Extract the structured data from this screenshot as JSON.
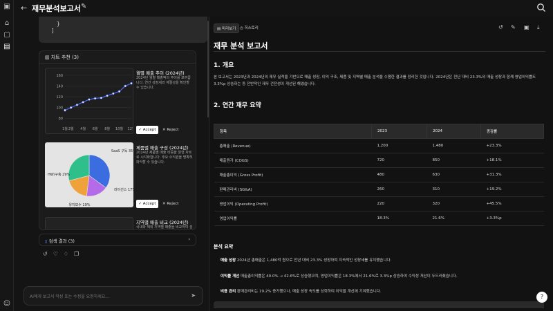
{
  "header": {
    "title": "재무분석보고서"
  },
  "chat": {
    "code_lines": [
      "}",
      "]"
    ],
    "recommend": {
      "label": "차트 추천 (3)",
      "cards": [
        {
          "title": "월별 매출 추이 (2024년)",
          "desc": "2024년 월별 매출액의 추이를 보여줍니다. 연간 성장세와 계절성을 확인할 수 있습니다.",
          "accept": "Accept",
          "reject": "Reject"
        },
        {
          "title": "제품별 매출 구성 (2024년)",
          "desc": "2024년 제품별 매출 비중을 원형 차트로 시각화합니다. 주요 수익원을 명확히 파악할 수 있습니다.",
          "accept": "Accept",
          "reject": "Reject"
        },
        {
          "title": "지역별 매출 비교 (2024년)",
          "desc": "국내와 해외 지역별 매출을 비교하여 성"
        }
      ]
    },
    "search_results": "검색 결과 (3)",
    "prompt_placeholder": "AI에게 보고서 작성 또는 수정을 요청하세요..."
  },
  "chart_data": [
    {
      "type": "line",
      "x": [
        "1월",
        "2월",
        "3월",
        "4월",
        "5월",
        "6월",
        "7월",
        "8월",
        "9월",
        "10월",
        "11월",
        "12월"
      ],
      "series": [
        {
          "values": [
            95,
            100,
            105,
            110,
            115,
            117,
            118,
            122,
            126,
            130,
            140,
            145
          ]
        }
      ],
      "xticks": [
        "1월",
        "2월",
        "4월",
        "6월",
        "8월",
        "10월",
        "12월"
      ],
      "yticks": [
        80,
        100,
        120,
        140,
        160
      ],
      "ylim": [
        70,
        165
      ],
      "color": "#4f6df5"
    },
    {
      "type": "pie",
      "slices": [
        {
          "label": "SaaS 구독 35%",
          "value": 35,
          "color": "#3b6ce0"
        },
        {
          "label": "라이선스 17%",
          "value": 17,
          "color": "#b36be8"
        },
        {
          "label": "유지보수 19%",
          "value": 19,
          "color": "#f0a23a"
        },
        {
          "label": "HW/구축 29%",
          "value": 29,
          "color": "#2fbf8a"
        }
      ]
    }
  ],
  "doc": {
    "tabs": [
      "미리보기",
      "히스토리"
    ],
    "title": "재무 분석 보고서",
    "sections": {
      "overview": "1. 개요",
      "overview_text": "본 보고서는 2023년과 2024년의 재무 실적을 기반으로 매출 성장, 이익 구조, 제품 및 지역별 매출 분석을 수행한 결과를 정리한 것입니다. 2024년은 전년 대비 23.3%의 매출 성장과 함께 영업이익률도 3.3%p 상승하는 등 전반적인 재무 건전성이 개선된 해였습니다.",
      "annual": "2. 연간 재무 요약",
      "analysis": "분석 요약"
    },
    "table": {
      "headers": [
        "항목",
        "2023",
        "2024",
        "증감률"
      ],
      "rows": [
        [
          "총매출 (Revenue)",
          "1,200",
          "1,480",
          "+23.3%"
        ],
        [
          "매출원가 (COGS)",
          "720",
          "850",
          "+18.1%"
        ],
        [
          "매출총이익 (Gross Profit)",
          "480",
          "630",
          "+31.3%"
        ],
        [
          "판매관리비 (SG&A)",
          "260",
          "310",
          "+19.2%"
        ],
        [
          "영업이익 (Operating Profit)",
          "220",
          "320",
          "+45.5%"
        ],
        [
          "영업이익률",
          "18.3%",
          "21.6%",
          "+3.3%p"
        ]
      ]
    },
    "summary": [
      {
        "label": "매출 성장",
        "text": "2024년 총매출은 1,480억 원으로 전년 대비 23.3% 성장하며 지속적인 성장세를 유지했습니다."
      },
      {
        "label": "이익률 개선",
        "text": "매출총이익률은 40.0% → 42.6%로 상승했으며, 영업이익률은 18.3%에서 21.6%로 3.3%p 상승하여 수익성 개선이 두드러졌습니다."
      },
      {
        "label": "비용 관리",
        "text": "판매관리비는 19.2% 증가했으나, 매출 성장 속도를 상회하여 이익을 개선에 기여했습니다."
      }
    ]
  }
}
